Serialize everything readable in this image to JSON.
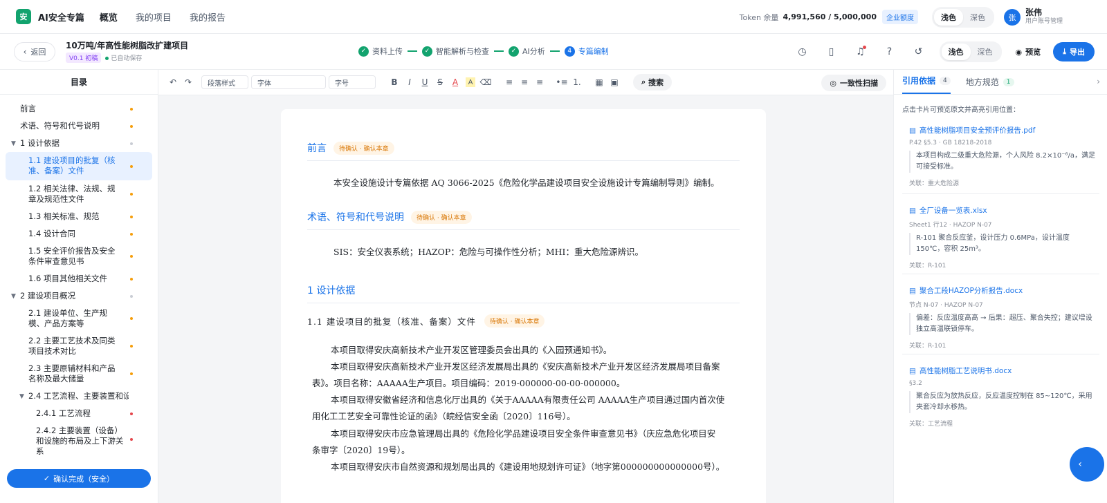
{
  "app": {
    "logo_char": "安",
    "brand": "AI安全专篇",
    "nav": [
      "概览",
      "我的项目",
      "我的报告"
    ]
  },
  "top_right": {
    "token_label": "Token 余量",
    "token_value": "4,991,560 / 5,000,000",
    "enterprise_badge": "企业额度",
    "theme_light": "浅色",
    "theme_dark": "深色",
    "avatar_char": "张",
    "user_name": "张伟",
    "user_role": "用户账号管理"
  },
  "subbar": {
    "back": "返回",
    "project_title": "10万吨/年高性能树脂改扩建项目",
    "version": "V0.1 初稿",
    "saved": "已自动保存",
    "steps": [
      {
        "label": "资料上传",
        "mark": "✓"
      },
      {
        "label": "智能解析与检查",
        "mark": "✓"
      },
      {
        "label": "AI分析",
        "mark": "✓"
      },
      {
        "label": "专篇编制",
        "mark": "4"
      }
    ],
    "theme_light": "浅色",
    "theme_dark": "深色",
    "preview": "预览",
    "export": "导出"
  },
  "toc": {
    "title": "目录",
    "confirm": "确认完成（安全）",
    "items": [
      {
        "text": "前言",
        "status": "pending"
      },
      {
        "text": "术语、符号和代号说明",
        "status": "pending"
      },
      {
        "text": "1 设计依据",
        "status": "none"
      },
      {
        "text": "1.1 建设项目的批复（核准、备案）文件",
        "status": "pending"
      },
      {
        "text": "1.2 相关法律、法规、规章及规范性文件",
        "status": "pending"
      },
      {
        "text": "1.3 相关标准、规范",
        "status": "pending"
      },
      {
        "text": "1.4 设计合同",
        "status": "pending"
      },
      {
        "text": "1.5 安全评价报告及安全条件审查意见书",
        "status": "pending"
      },
      {
        "text": "1.6 项目其他相关文件",
        "status": "pending"
      },
      {
        "text": "2 建设项目概况",
        "status": "none"
      },
      {
        "text": "2.1 建设单位、生产规模、产品方案等",
        "status": "pending"
      },
      {
        "text": "2.2 主要工艺技术及同类项目技术对比",
        "status": "pending"
      },
      {
        "text": "2.3 主要原辅材料和产品名称及最大储量",
        "status": "pending"
      },
      {
        "text": "2.4 工艺流程、主要装置和设",
        "status": "none"
      },
      {
        "text": "2.4.1 工艺流程",
        "status": "error"
      },
      {
        "text": "2.4.2 主要装置（设备）和设施的布局及上下游关系",
        "status": "error"
      }
    ]
  },
  "toolbar": {
    "para_style": "段落样式",
    "font": "字体",
    "size": "字号",
    "search": "搜索",
    "scan": "一致性扫描"
  },
  "doc": {
    "pending_label": "待确认 · 确认本章",
    "h_preface": "前言",
    "p_preface": "本安全设施设计专篇依据 AQ 3066-2025《危险化学品建设项目安全设施设计专篇编制导则》编制。",
    "h_terms": "术语、符号和代号说明",
    "p_terms": "SIS：安全仪表系统；HAZOP：危险与可操作性分析；MHI：重大危险源辨识。",
    "h1": "1 设计依据",
    "h11": "1.1 建设项目的批复（核准、备案）文件",
    "p1": "本项目取得安庆高新技术产业开发区管理委员会出具的《入园预通知书》。",
    "p2a": "本项目取得安庆高新技术产业开发区经济发展局出具的《安庆高新技术产业开发区经济发展局项目备案",
    "p2b": "表》。项目名称：AAAAA生产项目。项目编码：2019-000000-00-00-000000。",
    "p3a": "本项目取得安徽省经济和信息化厅出具的《关于AAAAA有限责任公司 AAAAA生产项目通过国内首次使",
    "p3b": "用化工工艺安全可靠性论证的函》（皖经信安全函〔2020〕116号）。",
    "p4a": "本项目取得安庆市应急管理局出具的《危险化学品建设项目安全条件审查意见书》（庆应急危化项目安",
    "p4b": "条审字〔2020〕19号）。",
    "p5": "本项目取得安庆市自然资源和规划局出具的《建设用地规划许可证》（地字第000000000000000号）。"
  },
  "refs": {
    "tab_cite": "引用依据",
    "tab_cite_count": "4",
    "tab_local": "地方规范",
    "tab_local_count": "1",
    "hint": "点击卡片可预览原文并高亮引用位置：",
    "cards": [
      {
        "title": "高性能树脂项目安全预评价报告.pdf",
        "meta": "P.42 §5.3 · GB 18218-2018",
        "quote": "本项目构成二级重大危险源，个人风险 8.2×10⁻⁶/a，满足可接受标准。",
        "rel": "关联：重大危险源"
      },
      {
        "title": "全厂设备一览表.xlsx",
        "meta": "Sheet1 行12 · HAZOP N-07",
        "quote": "R-101 聚合反应釜，设计压力 0.6MPa，设计温度 150℃，容积 25m³。",
        "rel": "关联：R-101"
      },
      {
        "title": "聚合工段HAZOP分析报告.docx",
        "meta": "节点 N-07 · HAZOP N-07",
        "quote": "偏差：反应温度高高 → 后果：超压、聚合失控；建议增设独立高温联锁停车。",
        "rel": "关联：R-101"
      },
      {
        "title": "高性能树脂工艺说明书.docx",
        "meta": "§3.2",
        "quote": "聚合反应为放热反应，反应温度控制在 85~120℃，采用夹套冷却水移热。",
        "rel": "关联：工艺流程"
      }
    ]
  },
  "colors": {
    "primary": "#1a73e8",
    "success": "#12a36e",
    "warning": "#f59e0b",
    "danger": "#e5484d"
  }
}
